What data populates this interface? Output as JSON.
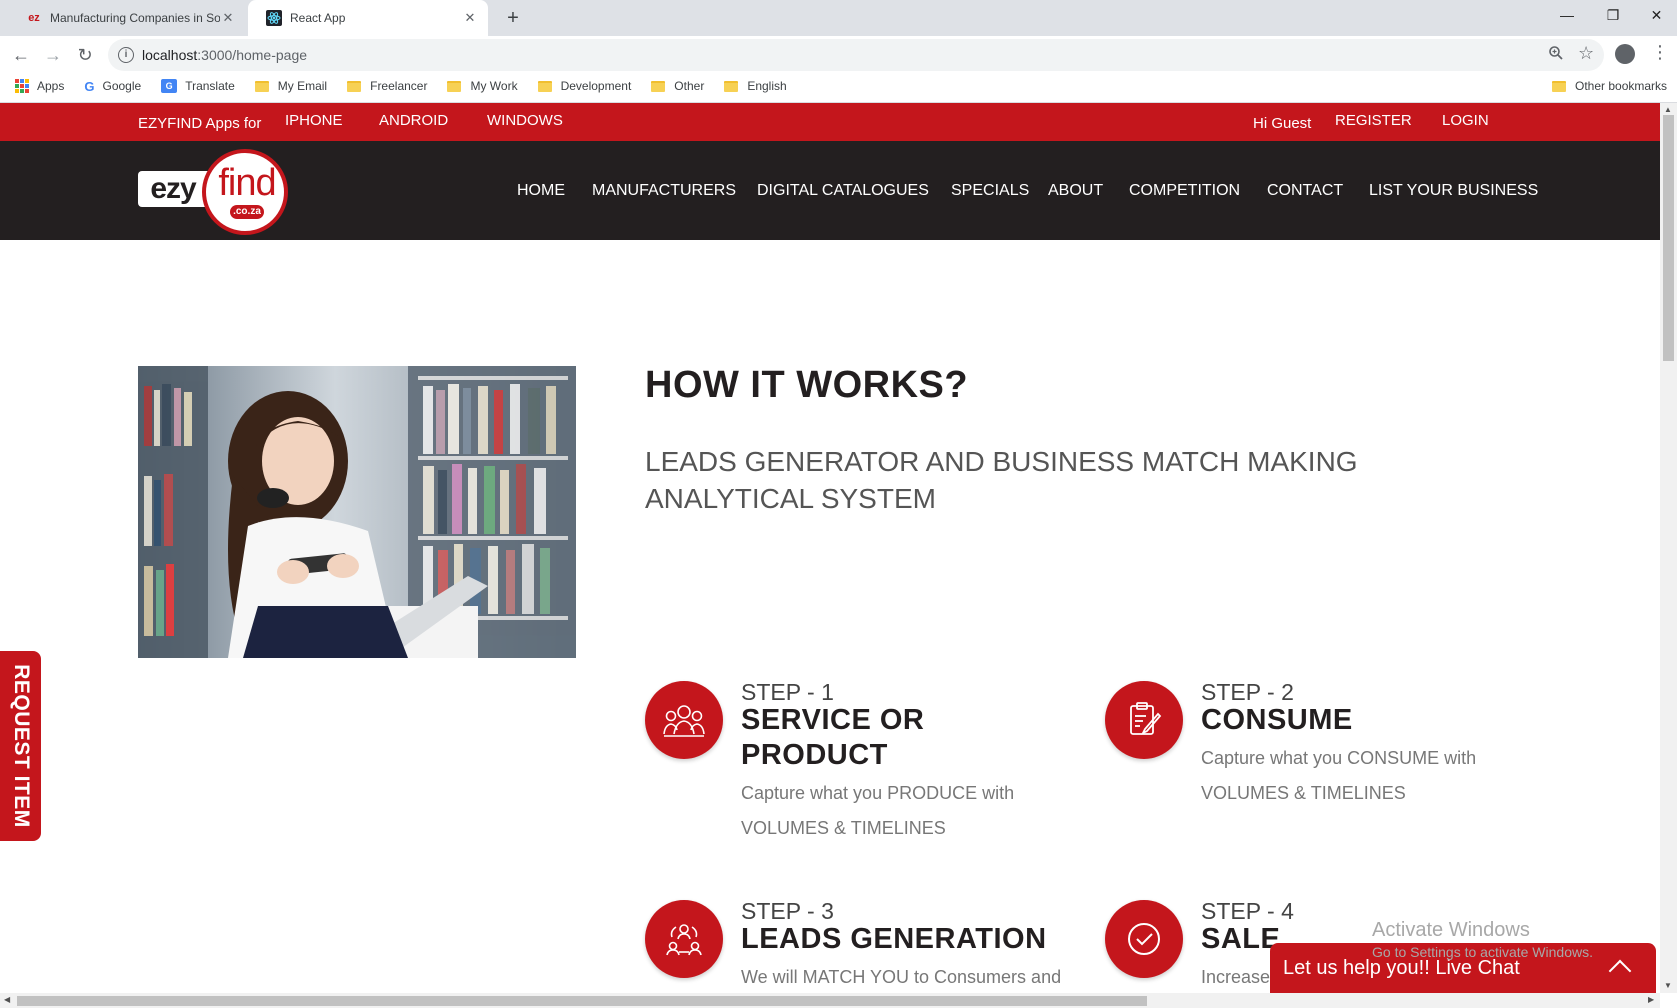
{
  "browser": {
    "tabs": [
      {
        "title": "Manufacturing Companies in Sou",
        "active": false
      },
      {
        "title": "React App",
        "active": true
      }
    ],
    "url_host": "localhost",
    "url_path": ":3000/home-page",
    "bookmarks": [
      "Apps",
      "Google",
      "Translate",
      "My Email",
      "Freelancer",
      "My Work",
      "Development",
      "Other",
      "English"
    ],
    "other_bookmarks": "Other bookmarks"
  },
  "topbar": {
    "apps_for": "EZYFIND Apps for",
    "platforms": [
      "IPHONE",
      "ANDROID",
      "WINDOWS"
    ],
    "greeting": "Hi Guest",
    "register": "REGISTER",
    "login": "LOGIN"
  },
  "logo": {
    "ezy": "ezy",
    "find": "find",
    "coza": ".co.za"
  },
  "nav": [
    "HOME",
    "MANUFACTURERS",
    "DIGITAL CATALOGUES",
    "SPECIALS",
    "ABOUT",
    "COMPETITION",
    "CONTACT",
    "LIST YOUR BUSINESS"
  ],
  "how": {
    "title": "HOW IT WORKS?",
    "subtitle": "LEADS GENERATOR AND BUSINESS MATCH MAKING ANALYTICAL SYSTEM"
  },
  "steps": [
    {
      "num": "STEP - 1",
      "name": "SERVICE OR PRODUCT",
      "desc": "Capture what you PRODUCE with VOLUMES & TIMELINES",
      "icon": "people-group-icon"
    },
    {
      "num": "STEP - 2",
      "name": "CONSUME",
      "desc": "Capture what you CONSUME with VOLUMES & TIMELINES",
      "icon": "edit-document-icon"
    },
    {
      "num": "STEP - 3",
      "name": "LEADS GENERATION",
      "desc": "We will MATCH YOU to Consumers and Suppliers by Location",
      "icon": "network-people-icon"
    },
    {
      "num": "STEP - 4",
      "name": "SALE",
      "desc": "Increase your SALES targets !!",
      "icon": "check-circle-icon"
    }
  ],
  "request_item": "REQUEST ITEM",
  "livechat": "Let us help you!! Live Chat",
  "watermark": {
    "line1": "Activate Windows",
    "line2": "Go to Settings to activate Windows."
  },
  "colors": {
    "brand_red": "#c4161c",
    "nav_dark": "#231f20"
  }
}
